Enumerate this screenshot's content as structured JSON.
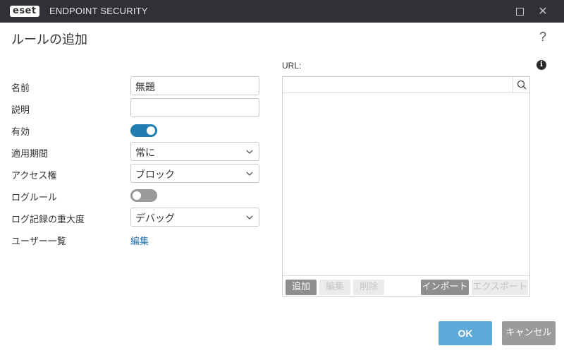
{
  "window": {
    "app_logo": "eset",
    "app_title": "ENDPOINT SECURITY",
    "maximize_icon": "maximize-icon",
    "close_icon": "close-icon"
  },
  "dialog": {
    "title": "ルールの追加",
    "help": "?"
  },
  "form": {
    "name": {
      "label": "名前",
      "value": "無題"
    },
    "description": {
      "label": "説明",
      "value": ""
    },
    "enabled": {
      "label": "有効",
      "state": "on"
    },
    "period": {
      "label": "適用期間",
      "value": "常に"
    },
    "access": {
      "label": "アクセス権",
      "value": "ブロック"
    },
    "log_rule": {
      "label": "ログルール",
      "state": "off"
    },
    "log_severity": {
      "label": "ログ記録の重大度",
      "value": "デバッグ"
    },
    "user_list": {
      "label": "ユーザー一覧",
      "link": "編集"
    }
  },
  "url": {
    "label": "URL:",
    "info_icon": "info-icon",
    "search_placeholder": "",
    "search_icon": "search-icon",
    "toolbar": {
      "add": "追加",
      "edit": "編集",
      "delete": "削除",
      "import": "インポート",
      "export": "エクスポート"
    }
  },
  "footer": {
    "ok": "OK",
    "cancel": "キャンセル"
  },
  "colors": {
    "titlebar": "#2f3136",
    "accent": "#1f7db0",
    "ok_button": "#5fa9d8",
    "link": "#1a70a8"
  }
}
